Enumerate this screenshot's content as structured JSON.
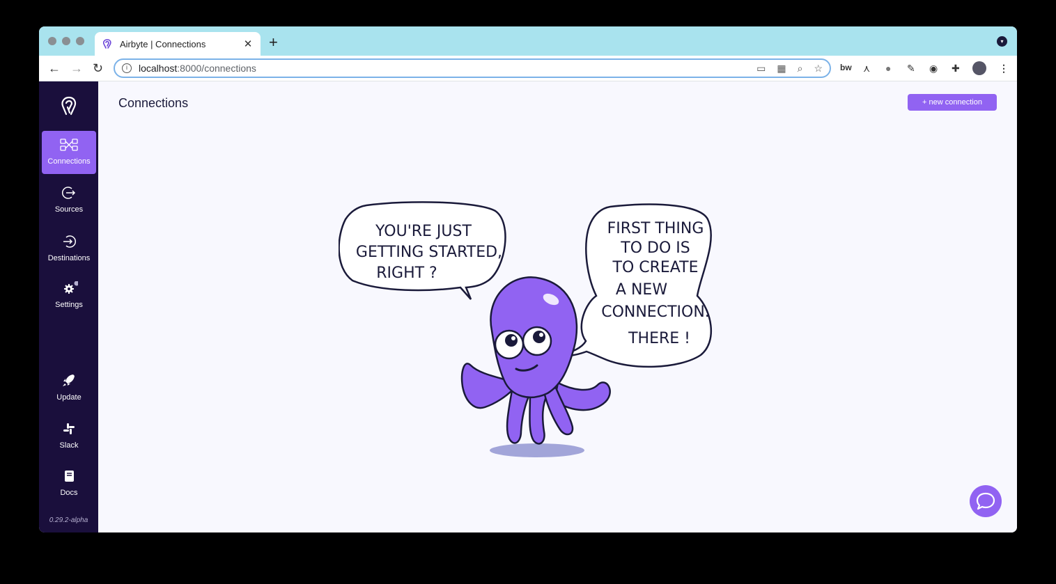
{
  "browser": {
    "tab_title": "Airbyte | Connections",
    "tab_close": "✕",
    "new_tab": "+",
    "url_host": "localhost",
    "url_path": ":8000/connections"
  },
  "sidebar": {
    "items": [
      {
        "label": "Connections"
      },
      {
        "label": "Sources"
      },
      {
        "label": "Destinations"
      },
      {
        "label": "Settings"
      },
      {
        "label": "Update"
      },
      {
        "label": "Slack"
      },
      {
        "label": "Docs"
      }
    ],
    "version": "0.29.2-alpha"
  },
  "page": {
    "title": "Connections",
    "new_button": "+ new connection"
  },
  "illustration": {
    "left_bubble": [
      "YOU'RE JUST",
      "GETTING STARTED,",
      "RIGHT ?"
    ],
    "right_bubble": [
      "FIRST THING",
      "TO DO IS",
      "TO CREATE",
      "A NEW",
      "CONNECTION.",
      "THERE !"
    ]
  },
  "colors": {
    "accent": "#9163f2",
    "sidebar_bg": "#1a0f3c",
    "browser_chrome": "#a9e3ee"
  }
}
